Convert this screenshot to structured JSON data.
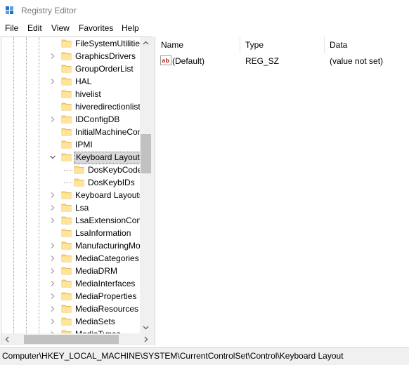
{
  "window": {
    "title": "Registry Editor",
    "accent_color": "#1e73c8"
  },
  "menu": [
    "File",
    "Edit",
    "View",
    "Favorites",
    "Help"
  ],
  "tree": {
    "items": [
      {
        "label": "FileSystemUtilities",
        "expandable": false,
        "level": 0
      },
      {
        "label": "GraphicsDrivers",
        "expandable": true,
        "level": 0
      },
      {
        "label": "GroupOrderList",
        "expandable": false,
        "level": 0
      },
      {
        "label": "HAL",
        "expandable": true,
        "level": 0
      },
      {
        "label": "hivelist",
        "expandable": false,
        "level": 0
      },
      {
        "label": "hiveredirectionlist",
        "expandable": false,
        "level": 0
      },
      {
        "label": "IDConfigDB",
        "expandable": true,
        "level": 0
      },
      {
        "label": "InitialMachineConfig",
        "expandable": false,
        "level": 0
      },
      {
        "label": "IPMI",
        "expandable": false,
        "level": 0
      },
      {
        "label": "Keyboard Layout",
        "expandable": true,
        "expanded": true,
        "selected": true,
        "level": 0
      },
      {
        "label": "DosKeybCodes",
        "expandable": false,
        "level": 1
      },
      {
        "label": "DosKeybIDs",
        "expandable": false,
        "level": 1
      },
      {
        "label": "Keyboard Layouts",
        "expandable": true,
        "level": 0
      },
      {
        "label": "Lsa",
        "expandable": true,
        "level": 0
      },
      {
        "label": "LsaExtensionConfig",
        "expandable": true,
        "level": 0
      },
      {
        "label": "LsaInformation",
        "expandable": false,
        "level": 0
      },
      {
        "label": "ManufacturingMode",
        "expandable": true,
        "level": 0
      },
      {
        "label": "MediaCategories",
        "expandable": true,
        "level": 0
      },
      {
        "label": "MediaDRM",
        "expandable": true,
        "level": 0
      },
      {
        "label": "MediaInterfaces",
        "expandable": true,
        "level": 0
      },
      {
        "label": "MediaProperties",
        "expandable": true,
        "level": 0
      },
      {
        "label": "MediaResources",
        "expandable": true,
        "level": 0
      },
      {
        "label": "MediaSets",
        "expandable": true,
        "level": 0
      },
      {
        "label": "MediaTypes",
        "expandable": true,
        "level": 0
      }
    ]
  },
  "list": {
    "columns": [
      "Name",
      "Type",
      "Data"
    ],
    "rows": [
      {
        "name": "(Default)",
        "type": "REG_SZ",
        "data": "(value not set)",
        "icon": "string-value-icon"
      }
    ]
  },
  "status": {
    "path": "Computer\\HKEY_LOCAL_MACHINE\\SYSTEM\\CurrentControlSet\\Control\\Keyboard Layout"
  }
}
